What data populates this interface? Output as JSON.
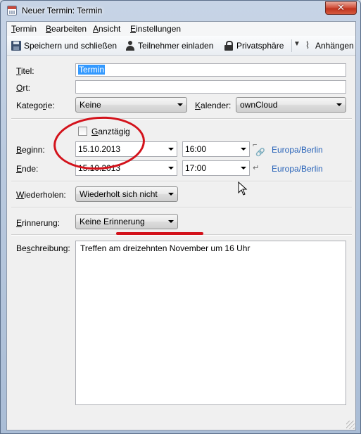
{
  "window": {
    "title": "Neuer Termin: Termin",
    "close_glyph": "✕"
  },
  "menu": [
    {
      "label": "Termin",
      "mnemonic": "T",
      "rest": "ermin"
    },
    {
      "label": "Bearbeiten",
      "mnemonic": "B",
      "rest": "earbeiten"
    },
    {
      "label": "Ansicht",
      "mnemonic": "A",
      "rest": "nsicht"
    },
    {
      "label": "Einstellungen",
      "mnemonic": "E",
      "rest": "instellungen"
    }
  ],
  "toolbar": {
    "save_label": "Speichern und schließen",
    "invite_label": "Teilnehmer einladen",
    "privacy_label": "Privatsphäre",
    "attach_label": "Anhängen",
    "icons": {
      "save": "save-icon",
      "invite": "person-icon",
      "privacy": "lock-icon",
      "attach": "paperclip-icon"
    }
  },
  "form": {
    "title": {
      "label_mn": "T",
      "label_rest": "itel:",
      "value": "Termin"
    },
    "location": {
      "label_mn": "O",
      "label_rest": "rt:",
      "value": ""
    },
    "category": {
      "label_pre": "Katego",
      "label_mn": "r",
      "label_rest": "ie:",
      "value": "Keine"
    },
    "calendar": {
      "label_mn": "K",
      "label_rest": "alender:",
      "value": "ownCloud"
    },
    "allday": {
      "label_mn": "G",
      "label_rest": "anztägig",
      "checked": false
    },
    "start": {
      "label_mn": "B",
      "label_rest": "eginn:",
      "date": "15.10.2013",
      "time": "16:00",
      "timezone": "Europa/Berlin"
    },
    "end": {
      "label_mn": "E",
      "label_rest": "nde:",
      "date": "15.10.2013",
      "time": "17:00",
      "timezone": "Europa/Berlin"
    },
    "repeat": {
      "label_mn": "W",
      "label_rest": "iederholen:",
      "value": "Wiederholt sich nicht"
    },
    "reminder": {
      "label_mn": "E",
      "label_rest": "rinnerung:",
      "value": "Keine Erinnerung"
    },
    "description": {
      "label_pre": "Be",
      "label_mn": "s",
      "label_rest": "chreibung:",
      "value": "Treffen am dreizehnten November um 16 Uhr"
    }
  },
  "colors": {
    "annotation": "#d3121b",
    "link": "#2762b8",
    "selection": "#3399ff"
  }
}
